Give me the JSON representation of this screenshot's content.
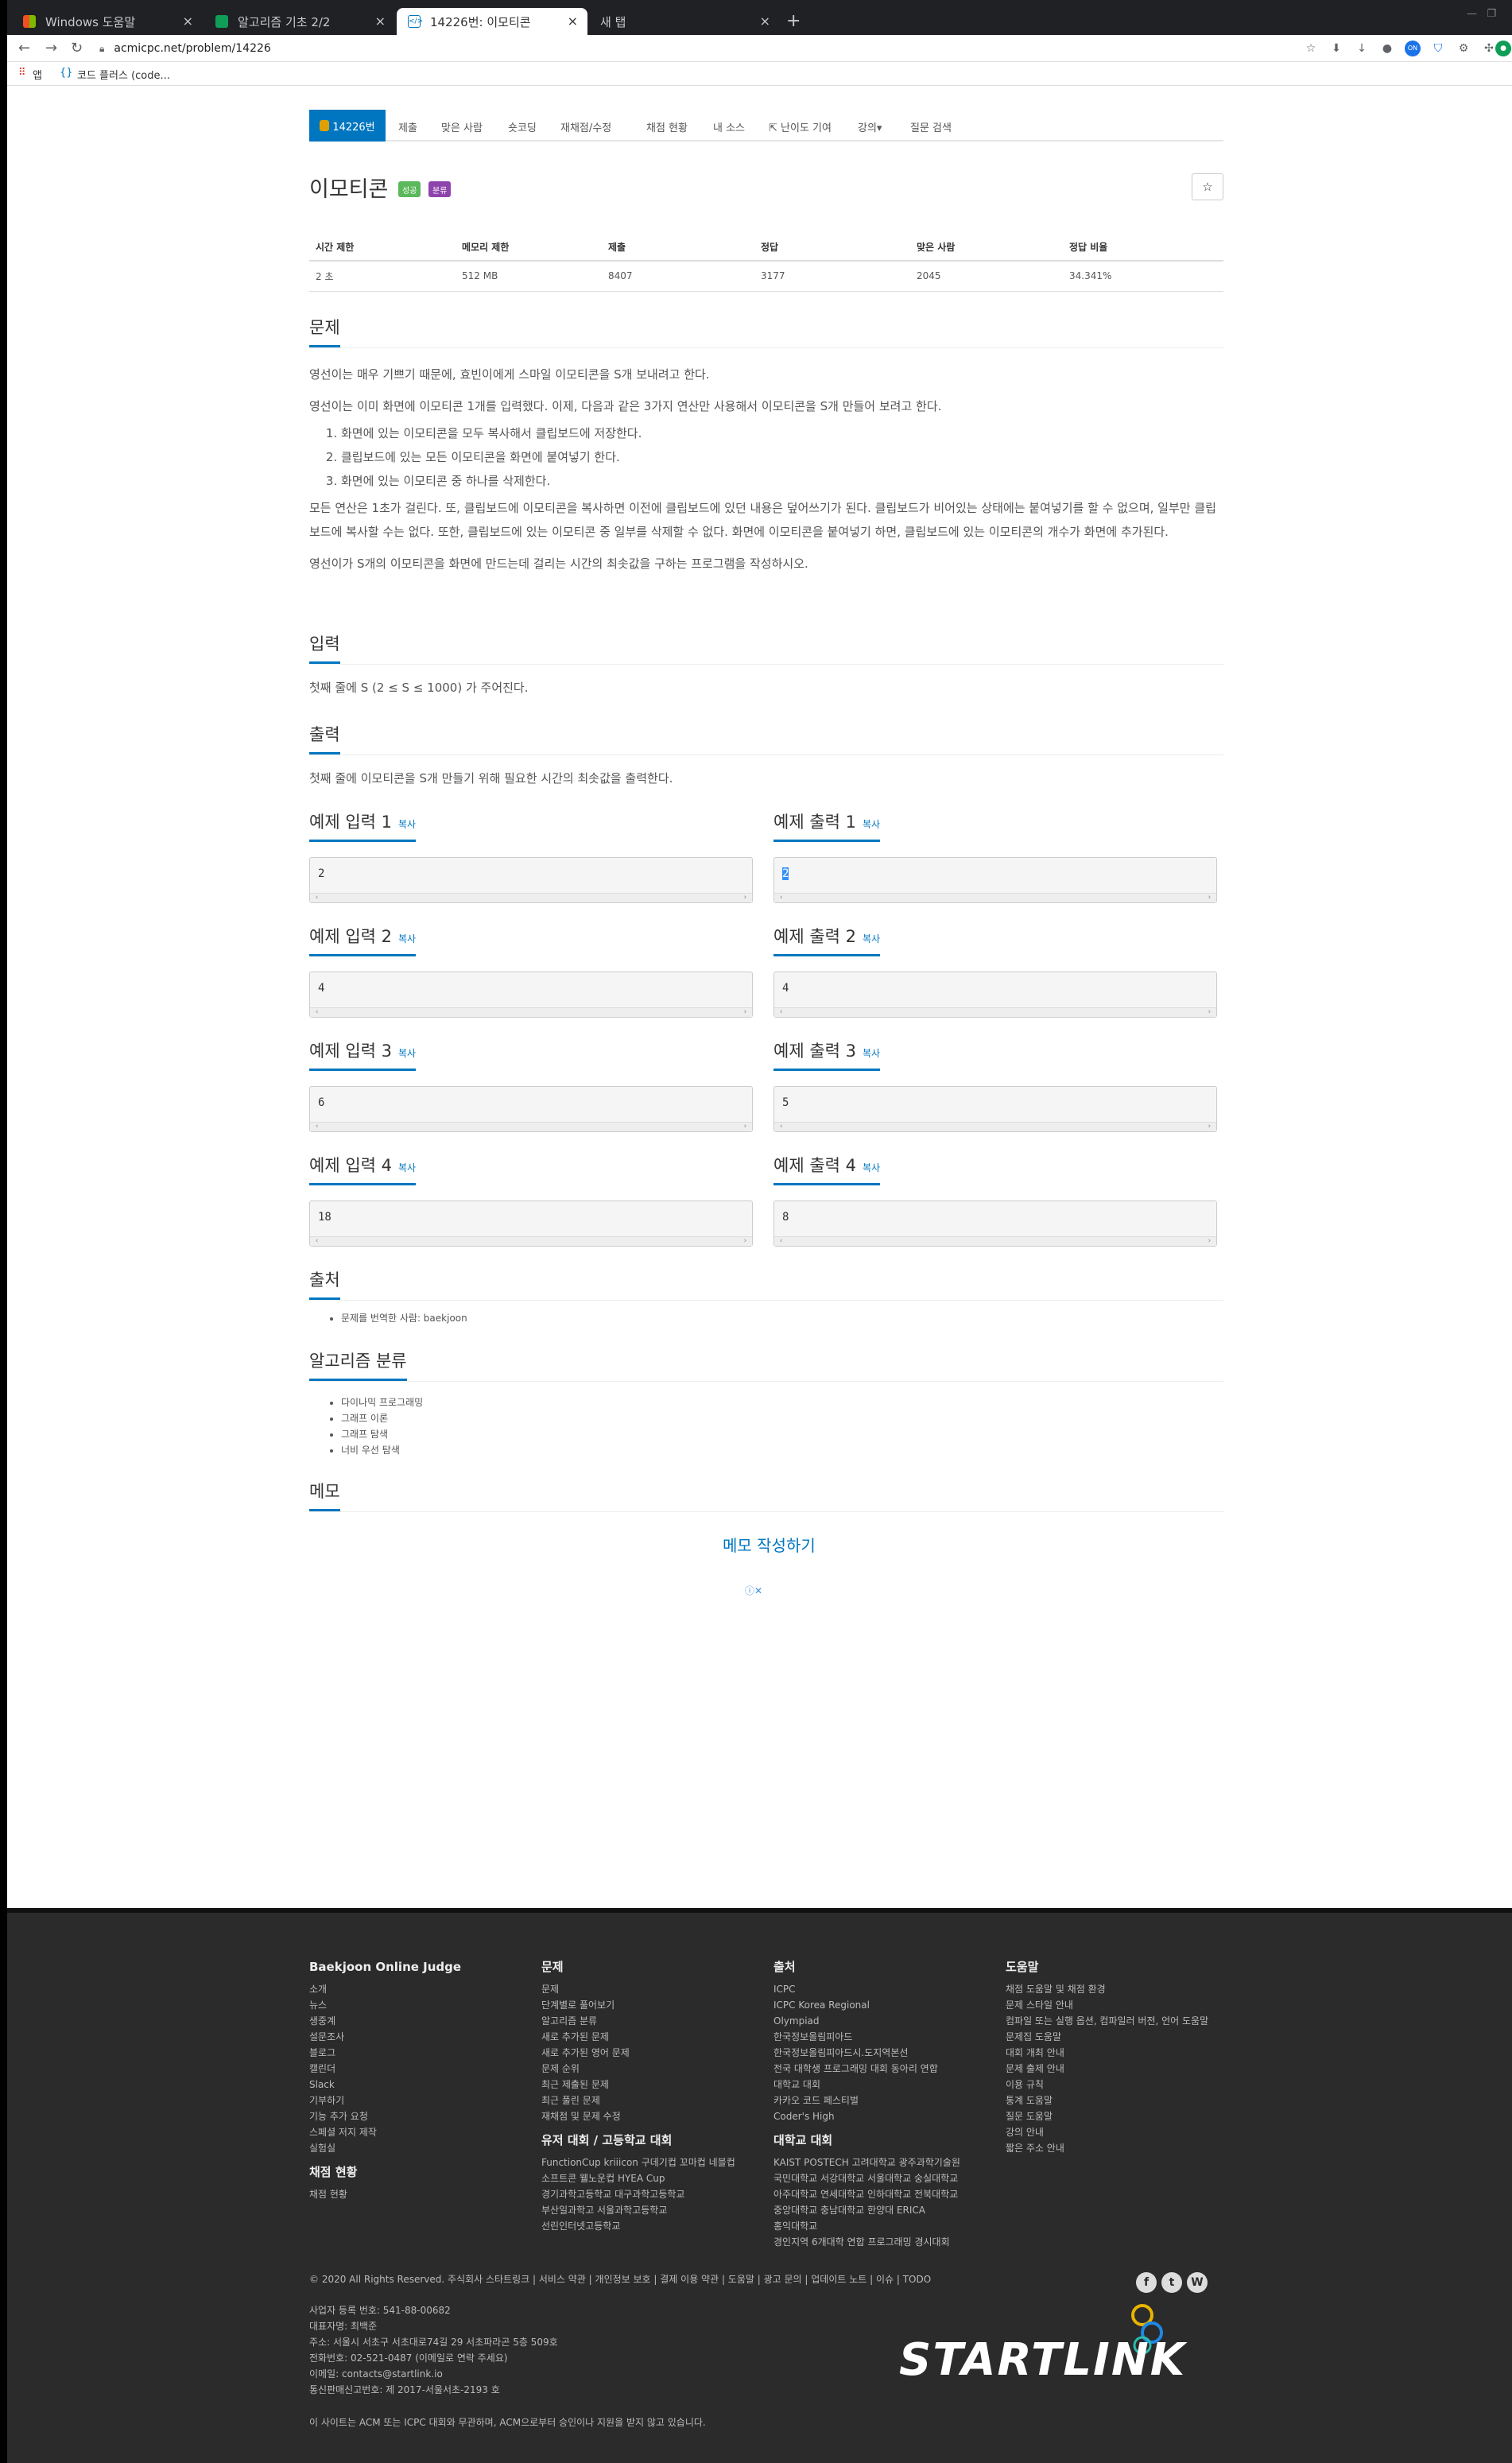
{
  "browser": {
    "tabs": [
      {
        "title": "Windows 도움말"
      },
      {
        "title": "알고리즘 기초 2/2"
      },
      {
        "title": "14226번: 이모티콘"
      },
      {
        "title": "새 탭"
      }
    ],
    "new_tab": "+",
    "url": "acmicpc.net/problem/14226",
    "bookmarks": [
      "앱",
      "코드 플러스 (code..."
    ]
  },
  "nav": {
    "items": [
      "14226번",
      "제출",
      "맞은 사람",
      "숏코딩",
      "재채점/수정",
      "채점 현황",
      "내 소스",
      "난이도 기여",
      "강의▾",
      "질문 검색"
    ]
  },
  "problem": {
    "title": "이모티콘",
    "badges": [
      "성공",
      "분류"
    ],
    "star": "☆",
    "info_headers": [
      "시간 제한",
      "메모리 제한",
      "제출",
      "정답",
      "맞은 사람",
      "정답 비율"
    ],
    "info_values": [
      "2 초",
      "512 MB",
      "8407",
      "3177",
      "2045",
      "34.341%"
    ],
    "sections": {
      "problem": "문제",
      "input": "입력",
      "output": "출력",
      "source": "출처",
      "algo": "알고리즘 분류",
      "memo": "메모"
    },
    "desc": [
      "영선이는 매우 기쁘기 때문에, 효빈이에게 스마일 이모티콘을 S개 보내려고 한다.",
      "영선이는 이미 화면에 이모티콘 1개를 입력했다. 이제, 다음과 같은 3가지 연산만 사용해서 이모티콘을 S개 만들어 보려고 한다.",
      "모든 연산은 1초가 걸린다. 또, 클립보드에 이모티콘을 복사하면 이전에 클립보드에 있던 내용은 덮어쓰기가 된다. 클립보드가 비어있는 상태에는 붙여넣기를 할 수 없으며, 일부만 클립보드에 복사할 수는 없다. 또한, 클립보드에 있는 이모티콘 중 일부를 삭제할 수 없다. 화면에 이모티콘을 붙여넣기 하면, 클립보드에 있는 이모티콘의 개수가 화면에 추가된다.",
      "영선이가 S개의 이모티콘을 화면에 만드는데 걸리는 시간의 최솟값을 구하는 프로그램을 작성하시오."
    ],
    "ops": [
      "화면에 있는 이모티콘을 모두 복사해서 클립보드에 저장한다.",
      "클립보드에 있는 모든 이모티콘을 화면에 붙여넣기 한다.",
      "화면에 있는 이모티콘 중 하나를 삭제한다."
    ],
    "input_desc": "첫째 줄에 S (2 ≤ S ≤ 1000) 가 주어진다.",
    "output_desc": "첫째 줄에 이모티콘을 S개 만들기 위해 필요한 시간의 최솟값을 출력한다.",
    "copy": "복사",
    "samples": [
      {
        "in_title": "예제 입력 1",
        "in": "2",
        "out_title": "예제 출력 1",
        "out": "2"
      },
      {
        "in_title": "예제 입력 2",
        "in": "4",
        "out_title": "예제 출력 2",
        "out": "4"
      },
      {
        "in_title": "예제 입력 3",
        "in": "6",
        "out_title": "예제 출력 3",
        "out": "5"
      },
      {
        "in_title": "예제 입력 4",
        "in": "18",
        "out_title": "예제 출력 4",
        "out": "8"
      }
    ],
    "source_text": "문제를 번역한 사람: baekjoon",
    "algorithms": [
      "다이나믹 프로그래밍",
      "그래프 이론",
      "그래프 탐색",
      "너비 우선 탐색"
    ],
    "memo_link": "메모 작성하기",
    "ad": "ⓘ✕"
  },
  "footer": {
    "cols": [
      {
        "title": "Baekjoon Online Judge",
        "items": [
          "소개",
          "뉴스",
          "생중계",
          "설문조사",
          "블로그",
          "캘린더",
          "Slack",
          "기부하기",
          "기능 추가 요청",
          "스페셜 저지 제작",
          "실험실"
        ],
        "title2": "채점 현황",
        "items2": [
          "채점 현황"
        ]
      },
      {
        "title": "문제",
        "items": [
          "문제",
          "단계별로 풀어보기",
          "알고리즘 분류",
          "새로 추가된 문제",
          "새로 추가된 영어 문제",
          "문제 순위",
          "최근 제출된 문제",
          "최근 풀린 문제",
          "재채점 및 문제 수정"
        ],
        "title2": "유저 대회 / 고등학교 대회",
        "items2": [
          "FunctionCup kriiicon 구데기컵 꼬마컵 네블컵",
          "소프트콘 웰노운컵 HYEA Cup",
          "경기과학고등학교 대구과학고등학교",
          "부산일과학고 서울과학고등학교",
          "선린인터넷고등학교"
        ]
      },
      {
        "title": "출처",
        "items": [
          "ICPC",
          "ICPC Korea Regional",
          "Olympiad",
          "한국정보올림피아드",
          "한국정보올림피아드시.도지역본선",
          "전국 대학생 프로그래밍 대회 동아리 연합",
          "대학교 대회",
          "카카오 코드 페스티벌",
          "Coder's High"
        ],
        "title2": "대학교 대회",
        "items2": [
          "KAIST POSTECH 고려대학교 광주과학기술원",
          "국민대학교 서강대학교 서울대학교 숭실대학교",
          "아주대학교 연세대학교 인하대학교 전북대학교",
          "중앙대학교 충남대학교 한양대 ERICA",
          "홍익대학교",
          "경인지역 6개대학 연합 프로그래밍 경시대회"
        ]
      },
      {
        "title": "도움말",
        "items": [
          "채점 도움말 및 채점 환경",
          "문제 스타일 안내",
          "컴파일 또는 실행 옵션, 컴파일러 버전, 언어 도움말",
          "문제집 도움말",
          "대회 개최 안내",
          "문제 출제 안내",
          "이용 규칙",
          "통계 도움말",
          "질문 도움말",
          "강의 안내",
          "짧은 주소 안내"
        ],
        "title2": "",
        "items2": []
      }
    ],
    "copyright": "© 2020 All Rights Reserved. 주식회사 스타트링크  |  서비스 약관  |  개인정보 보호  |  결제 이용 약관  |  도움말  |  광고 문의  |  업데이트 노트  |  이슈  |  TODO",
    "corp": [
      "사업자 등록 번호: 541-88-00682",
      "대표자명: 최백준",
      "주소: 서울시 서초구 서초대로74길 29 서초파라곤 5층 509호",
      "전화번호: 02-521-0487 (이메일로 연락 주세요)",
      "이메일: contacts@startlink.io",
      "통신판매신고번호: 제 2017-서울서초-2193 호"
    ],
    "disclaimer": "이 사이트는 ACM 또는 ICPC 대회와 무관하며, ACM으로부터 승인이나 지원을 받지 않고 있습니다.",
    "logo": "STARTLINK",
    "social": [
      "f",
      "t",
      "W"
    ]
  }
}
